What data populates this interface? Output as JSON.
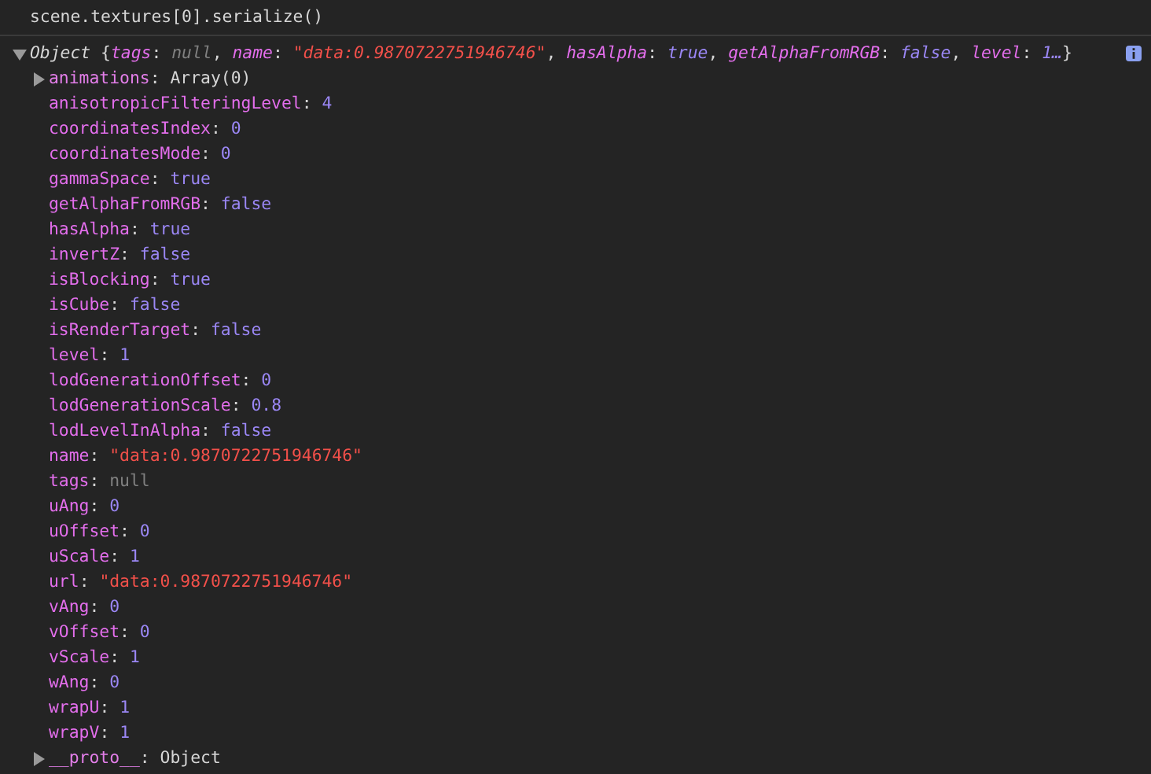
{
  "command": "scene.textures[0].serialize()",
  "result": {
    "expanded": true,
    "type_label": "Object",
    "open": "{",
    "close": "}",
    "sep": ": ",
    "delim": ", ",
    "preview": [
      {
        "key": "tags",
        "value": "null",
        "kind": "null"
      },
      {
        "key": "name",
        "value": "\"data:0.9870722751946746\"",
        "kind": "string"
      },
      {
        "key": "hasAlpha",
        "value": "true",
        "kind": "boolean"
      },
      {
        "key": "getAlphaFromRGB",
        "value": "false",
        "kind": "boolean"
      },
      {
        "key": "level",
        "value": "1…",
        "kind": "number"
      }
    ],
    "properties": [
      {
        "key": "animations",
        "value": "Array(0)",
        "kind": "object",
        "expanded": false
      },
      {
        "key": "anisotropicFilteringLevel",
        "value": "4",
        "kind": "number"
      },
      {
        "key": "coordinatesIndex",
        "value": "0",
        "kind": "number"
      },
      {
        "key": "coordinatesMode",
        "value": "0",
        "kind": "number"
      },
      {
        "key": "gammaSpace",
        "value": "true",
        "kind": "boolean"
      },
      {
        "key": "getAlphaFromRGB",
        "value": "false",
        "kind": "boolean"
      },
      {
        "key": "hasAlpha",
        "value": "true",
        "kind": "boolean"
      },
      {
        "key": "invertZ",
        "value": "false",
        "kind": "boolean"
      },
      {
        "key": "isBlocking",
        "value": "true",
        "kind": "boolean"
      },
      {
        "key": "isCube",
        "value": "false",
        "kind": "boolean"
      },
      {
        "key": "isRenderTarget",
        "value": "false",
        "kind": "boolean"
      },
      {
        "key": "level",
        "value": "1",
        "kind": "number"
      },
      {
        "key": "lodGenerationOffset",
        "value": "0",
        "kind": "number"
      },
      {
        "key": "lodGenerationScale",
        "value": "0.8",
        "kind": "number"
      },
      {
        "key": "lodLevelInAlpha",
        "value": "false",
        "kind": "boolean"
      },
      {
        "key": "name",
        "value": "\"data:0.9870722751946746\"",
        "kind": "string"
      },
      {
        "key": "tags",
        "value": "null",
        "kind": "null"
      },
      {
        "key": "uAng",
        "value": "0",
        "kind": "number"
      },
      {
        "key": "uOffset",
        "value": "0",
        "kind": "number"
      },
      {
        "key": "uScale",
        "value": "1",
        "kind": "number"
      },
      {
        "key": "url",
        "value": "\"data:0.9870722751946746\"",
        "kind": "string"
      },
      {
        "key": "vAng",
        "value": "0",
        "kind": "number"
      },
      {
        "key": "vOffset",
        "value": "0",
        "kind": "number"
      },
      {
        "key": "vScale",
        "value": "1",
        "kind": "number"
      },
      {
        "key": "wAng",
        "value": "0",
        "kind": "number"
      },
      {
        "key": "wrapU",
        "value": "1",
        "kind": "number"
      },
      {
        "key": "wrapV",
        "value": "1",
        "kind": "number"
      },
      {
        "key": "__proto__",
        "value": "Object",
        "kind": "object",
        "expanded": false
      }
    ]
  }
}
